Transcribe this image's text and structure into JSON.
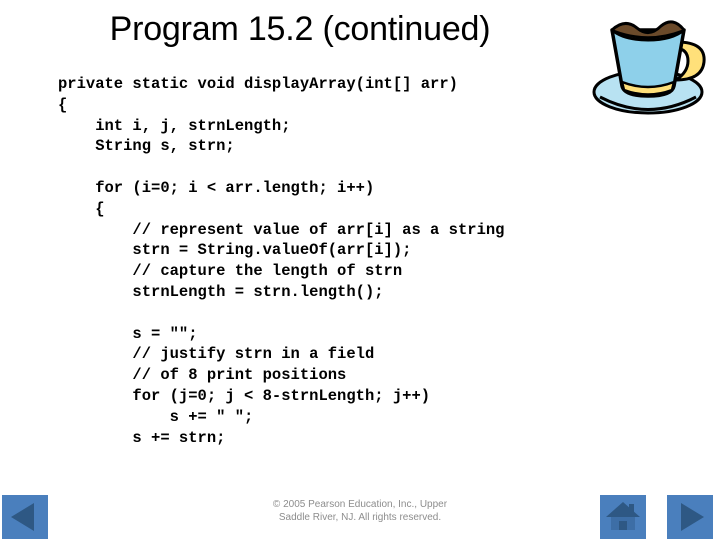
{
  "slide": {
    "title": "Program 15.2 (continued)"
  },
  "graphics": {
    "coffee_cup": {
      "icon": "coffee-cup-icon",
      "cup_color": "#8ed0ea",
      "handle_color": "#ffe07a",
      "coffee_color": "#6b4a2a",
      "saucer_color": "#b8e2f2",
      "outline_color": "#000000"
    }
  },
  "code": {
    "language": "java",
    "lines": [
      "private static void displayArray(int[] arr)",
      "{",
      "    int i, j, strnLength;",
      "    String s, strn;",
      "",
      "    for (i=0; i < arr.length; i++)",
      "    {",
      "        // represent value of arr[i] as a string",
      "        strn = String.valueOf(arr[i]);",
      "        // capture the length of strn",
      "        strnLength = strn.length();",
      "",
      "        s = \"\";",
      "        // justify strn in a field",
      "        // of 8 print positions",
      "        for (j=0; j < 8-strnLength; j++)",
      "            s += \" \";",
      "        s += strn;"
    ]
  },
  "footer": {
    "copyright_line1": "© 2005 Pearson Education, Inc., Upper",
    "copyright_line2": "Saddle River, NJ.  All rights reserved.",
    "text_color": "#8d8d8d"
  },
  "navigation": {
    "button_bg": "#4a7fbd",
    "glyph_color": "#2e5884",
    "buttons": [
      {
        "name": "previous-slide-button",
        "icon": "triangle-left-icon",
        "label": "Previous"
      },
      {
        "name": "home-slide-button",
        "icon": "home-icon",
        "label": "Home"
      },
      {
        "name": "next-slide-button",
        "icon": "triangle-right-icon",
        "label": "Next"
      }
    ]
  }
}
